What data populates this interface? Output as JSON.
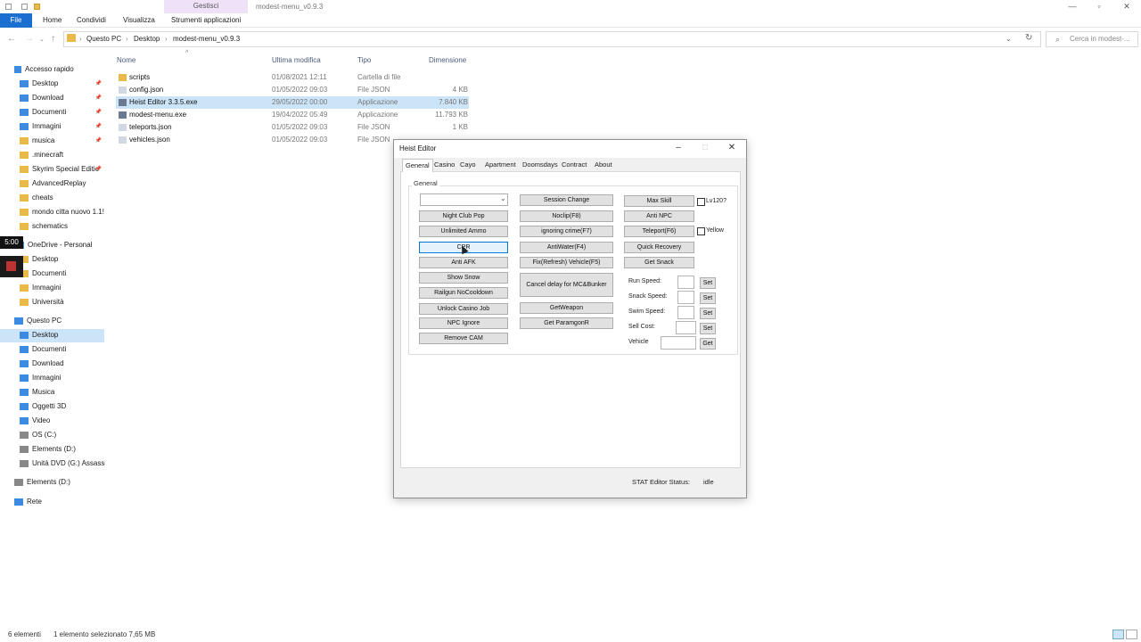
{
  "explorer": {
    "ribbon_context_label": "Gestisci",
    "window_title": "modest-menu_v0.9.3",
    "tabs": [
      "File",
      "Home",
      "Condividi",
      "Visualizza",
      "Strumenti applicazioni"
    ],
    "breadcrumb": [
      "Questo PC",
      "Desktop",
      "modest-menu_v0.9.3"
    ],
    "search_placeholder": "Cerca in modest-...",
    "columns": [
      "Nome",
      "Ultima modifica",
      "Tipo",
      "Dimensione"
    ],
    "files": [
      {
        "name": "scripts",
        "date": "01/08/2021 12:11",
        "type": "Cartella di file",
        "size": "",
        "icon": "folder-icon"
      },
      {
        "name": "config.json",
        "date": "01/05/2022 09:03",
        "type": "File JSON",
        "size": "4 KB",
        "icon": "file-icon"
      },
      {
        "name": "Heist Editor 3.3.5.exe",
        "date": "29/05/2022 00:00",
        "type": "Applicazione",
        "size": "7.840 KB",
        "icon": "app-icon"
      },
      {
        "name": "modest-menu.exe",
        "date": "19/04/2022 05:49",
        "type": "Applicazione",
        "size": "11.793 KB",
        "icon": "app-icon"
      },
      {
        "name": "teleports.json",
        "date": "01/05/2022 09:03",
        "type": "File JSON",
        "size": "1 KB",
        "icon": "file-icon"
      },
      {
        "name": "vehicles.json",
        "date": "01/05/2022 09:03",
        "type": "File JSON",
        "size": "",
        "icon": "file-icon"
      }
    ],
    "nav": {
      "quick_access": "Accesso rapido",
      "quick_items": [
        "Desktop",
        "Download",
        "Documenti",
        "Immagini",
        "musica",
        ".minecraft",
        "Skyrim Special Editic",
        "AdvancedReplay",
        "cheats",
        "mondo citta nuovo 1.1!",
        "schematics"
      ],
      "onedrive": "OneDrive - Personal",
      "onedrive_items": [
        "Desktop",
        "Documenti",
        "Immagini",
        "Università"
      ],
      "this_pc": "Questo PC",
      "pc_items": [
        "Desktop",
        "Documenti",
        "Download",
        "Immagini",
        "Musica",
        "Oggetti 3D",
        "Video",
        "OS (C:)",
        "Elements (D:)",
        "Unità DVD (G:) Assassin"
      ],
      "elements": "Elements (D:)",
      "network": "Rete"
    },
    "status_count": "6 elementi",
    "status_selected": "1 elemento selezionato  7,65 MB",
    "overlay_time": "5:00"
  },
  "heist": {
    "title": "Heist Editor",
    "tabs": [
      "General",
      "Casino",
      "Cayo",
      "Apartment",
      "Doomsdays",
      "Contract",
      "About"
    ],
    "group_label": "General",
    "col1": [
      "Night Club Pop",
      "Unlimited Ammo",
      "CPR",
      "Anti AFK",
      "Show Snow",
      "Railgun NoCooldown",
      "Unlock Casino Job",
      "NPC Ignore",
      "Remove CAM"
    ],
    "col2": [
      "Session Change",
      "Noclip(F8)",
      "ignoring crime(F7)",
      "AntiWater(F4)",
      "Fix(Refresh) Vehicle(F5)",
      "Cancel delay for MC&Bunker",
      "GetWeapon",
      "Get ParamgonR"
    ],
    "col3": [
      "Max Skill",
      "Anti NPC",
      "Teleport(F6)",
      "Quick Recovery",
      "Get Snack"
    ],
    "checkbox_lv120": "Lv120?",
    "checkbox_yellow": "Yellow",
    "fields": [
      {
        "label": "Run Speed:",
        "button": "Set"
      },
      {
        "label": "Snack Speed:",
        "button": "Set"
      },
      {
        "label": "Swim Speed:",
        "button": "Set"
      },
      {
        "label": "Sell Cost:",
        "button": "Set"
      },
      {
        "label": "Vehicle",
        "button": "Get"
      }
    ],
    "stat_label": "STAT Editor Status:",
    "stat_value": "idle"
  }
}
